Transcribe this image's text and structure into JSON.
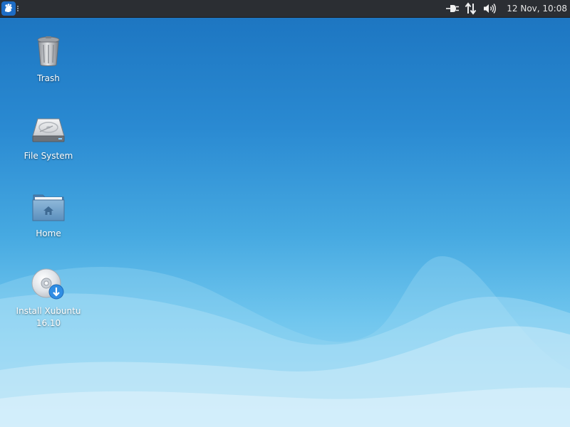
{
  "panel": {
    "menu_icon": "xfce-mouse-icon",
    "tray_icons": [
      "power-plug-icon",
      "network-arrows-icon",
      "volume-icon"
    ],
    "clock": "12 Nov, 10:08"
  },
  "desktop": {
    "icons": [
      {
        "label": "Trash",
        "icon": "trash-icon"
      },
      {
        "label": "File System",
        "icon": "hard-drive-icon"
      },
      {
        "label": "Home",
        "icon": "home-folder-icon"
      },
      {
        "label": "Install Xubuntu 16.10",
        "icon": "install-disc-icon"
      }
    ]
  },
  "colors": {
    "panel_bg": "#2b2e33",
    "wallpaper_top": "#1b73bf",
    "wallpaper_bottom": "#a7dcf5"
  }
}
